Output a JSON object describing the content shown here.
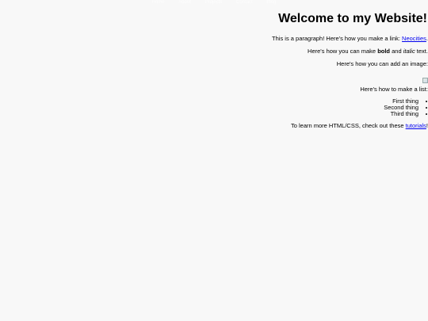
{
  "nav": {
    "items": [
      "Home",
      "About",
      "Projects",
      "Contact",
      "Blog"
    ]
  },
  "heading": "!Welcome to my Website",
  "paragraph1": {
    "text": ".This is a paragraph! Here's how you make a link: ",
    "link": "Neocities"
  },
  "paragraph2": {
    "before": ".Here's how you can make ",
    "bold": "bold",
    "middle": " and ",
    "italic": "italic",
    "after": " text"
  },
  "paragraph3": ":Here's how you can add an image",
  "paragraph4": ":Here's how to make a list",
  "list": [
    "First thing",
    "Second thing",
    "Third thing"
  ],
  "paragraph5": {
    "text": "!To learn more HTML/CSS, check out these ",
    "link": "tutorials"
  }
}
